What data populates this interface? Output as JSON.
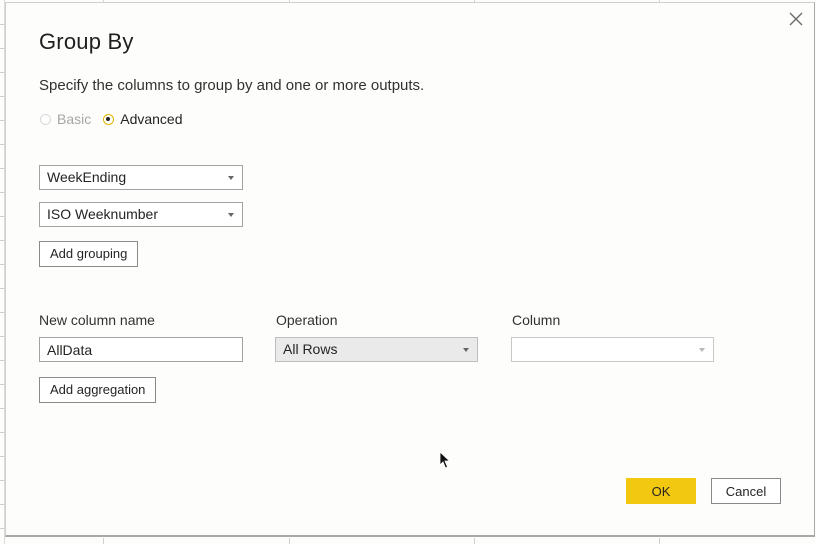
{
  "dialog": {
    "title": "Group By",
    "subtitle": "Specify the columns to group by and one or more outputs.",
    "close_icon": "close-icon"
  },
  "mode": {
    "options": [
      {
        "label": "Basic",
        "selected": false,
        "disabled": true
      },
      {
        "label": "Advanced",
        "selected": true,
        "disabled": false
      }
    ]
  },
  "grouping": {
    "columns": [
      {
        "value": "WeekEnding"
      },
      {
        "value": "ISO Weeknumber"
      }
    ],
    "add_button": "Add grouping"
  },
  "aggregation": {
    "headers": {
      "new_column_name": "New column name",
      "operation": "Operation",
      "column": "Column"
    },
    "rows": [
      {
        "new_column_name": "AllData",
        "operation": "All Rows",
        "column": ""
      }
    ],
    "add_button": "Add aggregation"
  },
  "footer": {
    "ok": "OK",
    "cancel": "Cancel"
  },
  "colors": {
    "accent": "#f2c811",
    "radio_selected": "#e2b400"
  }
}
